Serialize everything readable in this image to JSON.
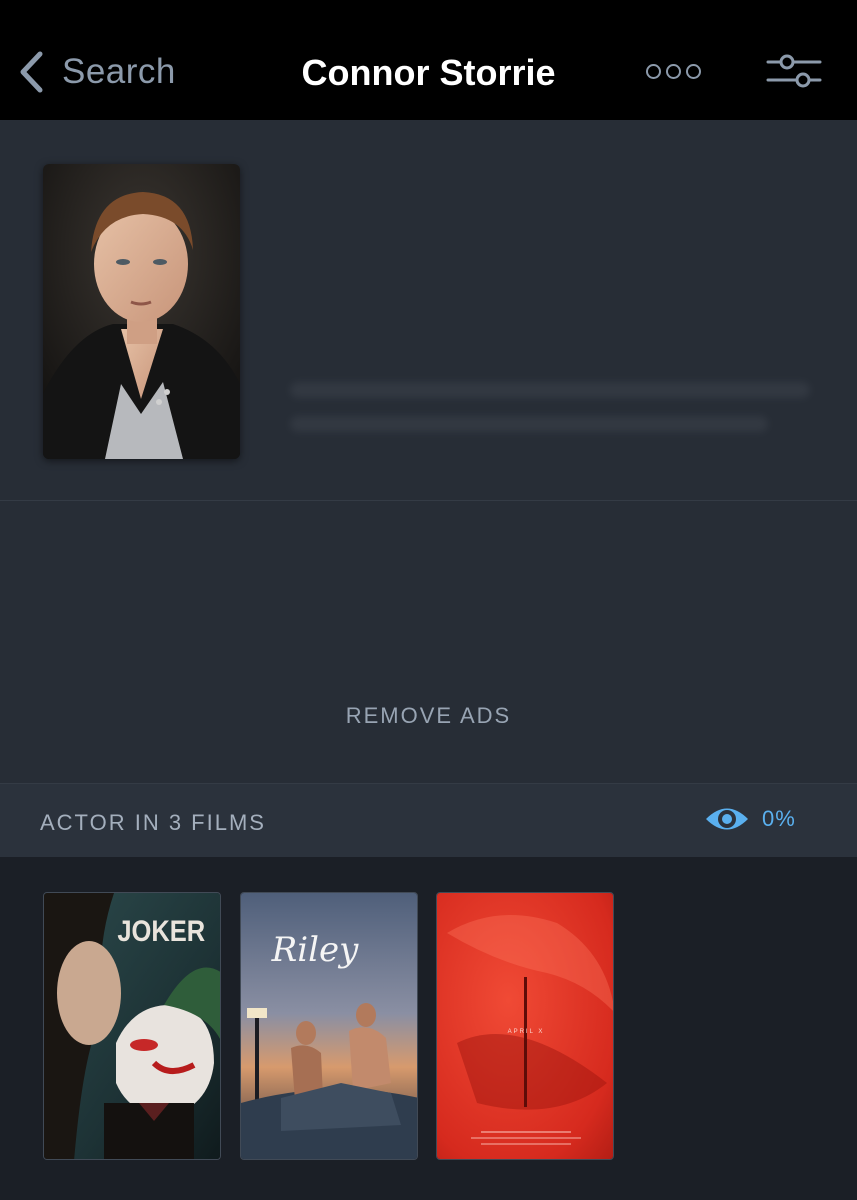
{
  "nav": {
    "back_label": "Search",
    "title": "Connor Storrie"
  },
  "ads": {
    "remove_label": "REMOVE ADS"
  },
  "filmography": {
    "section_label": "ACTOR IN 3 FILMS",
    "watched_percent": "0%",
    "accent_color": "#5ab0ef",
    "films": [
      {
        "poster_title": "JOKER"
      },
      {
        "poster_title": "Riley"
      },
      {
        "poster_title": "APRIL X"
      }
    ]
  },
  "icons": {
    "back": "chevron-left-icon",
    "more": "ellipsis-icon",
    "filter": "sliders-icon",
    "watched": "eye-icon"
  },
  "colors": {
    "topbar": "#000000",
    "panel": "#272d36",
    "section_header": "#2b323c",
    "background": "#1b1f26",
    "muted_text": "#8c9aab"
  }
}
